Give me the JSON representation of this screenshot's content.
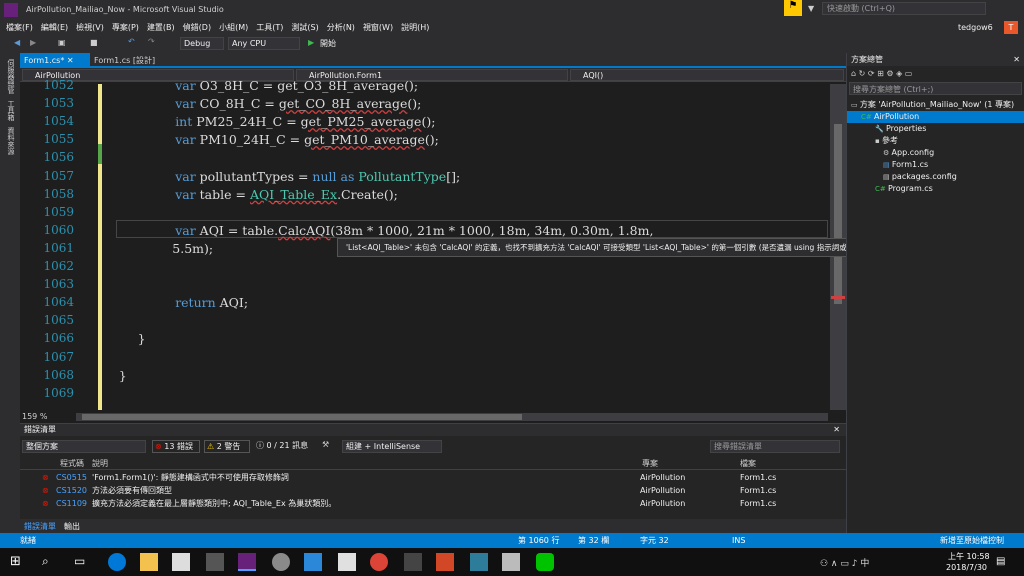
{
  "window": {
    "title": "AirPollution_Mailiao_Now - Microsoft Visual Studio",
    "quick_launch": "快速啟動 (Ctrl+Q)",
    "user": "tedgow6",
    "user_initial": "T"
  },
  "menu": [
    "檔案(F)",
    "編輯(E)",
    "檢視(V)",
    "專案(P)",
    "建置(B)",
    "偵錯(D)",
    "小組(M)",
    "工具(T)",
    "測試(S)",
    "分析(N)",
    "視窗(W)",
    "說明(H)"
  ],
  "toolbar": {
    "config": "Debug",
    "platform": "Any CPU",
    "start": "開始"
  },
  "left_tabs": [
    "伺服器總管",
    "工具箱",
    "資料來源"
  ],
  "doc_tabs": [
    {
      "label": "Form1.cs*",
      "active": true
    },
    {
      "label": "Form1.cs [設計]",
      "active": false
    }
  ],
  "nav": {
    "project": "AirPollution",
    "class": "AirPollution.Form1",
    "member": "AQI()"
  },
  "code": [
    {
      "n": "1052",
      "html": "<span class='kw'>var</span> O3_8H_C = get_O3_8H_average();"
    },
    {
      "n": "1053",
      "html": "<span class='kw'>var</span> CO_8H_C = <span class='sq'>get_CO_8H_average</span>();"
    },
    {
      "n": "1054",
      "html": "<span class='kw'>int</span> PM25_24H_C = <span class='sq'>get_PM25_average</span>();"
    },
    {
      "n": "1055",
      "html": "<span class='kw'>var</span> PM10_24H_C = <span class='sq'>get_PM10_average</span>();"
    },
    {
      "n": "1056",
      "html": ""
    },
    {
      "n": "1057",
      "html": "<span class='kw'>var</span> pollutantTypes = <span class='kw'>null</span> <span class='kw'>as</span> <span class='ty'>PollutantType</span>[];"
    },
    {
      "n": "1058",
      "html": "<span class='kw'>var</span> table = <span class='ty sq'>AQI_Table_Ex</span>.Create();"
    },
    {
      "n": "1059",
      "html": ""
    },
    {
      "n": "1060",
      "html": "<span class='kw'>var</span> AQI = table.<span class='sq'>CalcAQI</span>(38m * 1000, 21m * 1000, 18m, 34m, 0.30m, 1.8m,"
    },
    {
      "n": "1061",
      "html": "    5.5m);"
    },
    {
      "n": "1062",
      "html": ""
    },
    {
      "n": "1063",
      "html": ""
    },
    {
      "n": "1064",
      "html": "<span class='kw'>return</span> AQI;"
    },
    {
      "n": "1065",
      "html": ""
    },
    {
      "n": "1066",
      "html": "}"
    },
    {
      "n": "1067",
      "html": ""
    },
    {
      "n": "1068",
      "html": "}"
    },
    {
      "n": "1069",
      "html": ""
    }
  ],
  "tooltip": "'List<AQI_Table>' 未包含 'CalcAQI' 的定義，也找不到擴充方法 'CalcAQI' 可接受類型 'List<AQI_Table>' 的第一個引數 (是否遺漏 using 指示詞或組件參考?)",
  "zoom": "159 %",
  "errors": {
    "panel_title": "錯誤清單",
    "scope": "整個方案",
    "errors_btn": "13 錯誤",
    "warnings_btn": "2 警告",
    "messages_btn": "0 / 21 訊息",
    "build_filter": "組建 + IntelliSense",
    "search": "搜尋錯誤清單",
    "headers": {
      "code": "程式碼",
      "desc": "說明",
      "project": "專案",
      "file": "檔案"
    },
    "rows": [
      {
        "code": "CS0515",
        "desc": "'Form1.Form1()': 靜態建構函式中不可使用存取修飾詞",
        "project": "AirPollution",
        "file": "Form1.cs"
      },
      {
        "code": "CS1520",
        "desc": "方法必須要有傳回類型",
        "project": "AirPollution",
        "file": "Form1.cs"
      },
      {
        "code": "CS1109",
        "desc": "擴充方法必須定義在最上層靜態類別中; AQI_Table_Ex 為巢狀類別。",
        "project": "AirPollution",
        "file": "Form1.cs"
      }
    ],
    "bottom_tabs": [
      "錯誤清單",
      "輸出"
    ]
  },
  "solution": {
    "title": "方案總管",
    "search": "搜尋方案總管 (Ctrl+;)",
    "items": [
      "方案 'AirPollution_Mailiao_Now' (1 專案)",
      "AirPollution",
      "Properties",
      "參考",
      "App.config",
      "Form1.cs",
      "packages.config",
      "Program.cs"
    ]
  },
  "status": {
    "left": "就緒",
    "line": "第 1060 行",
    "col": "第 32 欄",
    "char": "字元 32",
    "ins": "INS",
    "scm": "新增至原始檔控制"
  },
  "taskbar": {
    "time": "上午 10:58",
    "date": "2018/7/30"
  },
  "colors": {
    "accent": "#007acc",
    "vs_purple": "#68217a"
  }
}
